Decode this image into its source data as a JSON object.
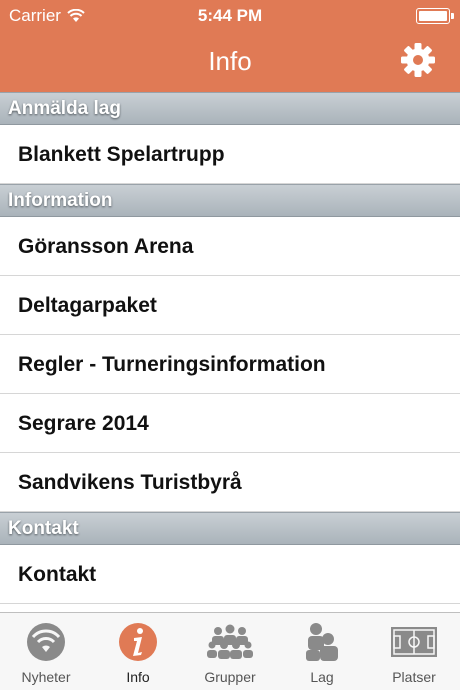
{
  "status_bar": {
    "carrier": "Carrier",
    "time": "5:44 PM"
  },
  "nav": {
    "title": "Info",
    "settings_icon": "gear-icon"
  },
  "sections": [
    {
      "header": "Anmälda lag",
      "rows": [
        "Blankett Spelartrupp"
      ]
    },
    {
      "header": "Information",
      "rows": [
        "Göransson Arena",
        "Deltagarpaket",
        "Regler - Turneringsinformation",
        "Segrare 2014",
        "Sandvikens Turistbyrå"
      ]
    },
    {
      "header": "Kontakt",
      "rows": [
        "Kontakt"
      ]
    }
  ],
  "tabs": [
    {
      "label": "Nyheter",
      "icon": "wifi-news-icon"
    },
    {
      "label": "Info",
      "icon": "info-icon",
      "active": true
    },
    {
      "label": "Grupper",
      "icon": "group-icon"
    },
    {
      "label": "Lag",
      "icon": "team-icon"
    },
    {
      "label": "Platser",
      "icon": "field-icon"
    }
  ],
  "colors": {
    "accent": "#e07a55",
    "section_header": "#aab3ba",
    "tab_icon": "#8a8a8a"
  }
}
